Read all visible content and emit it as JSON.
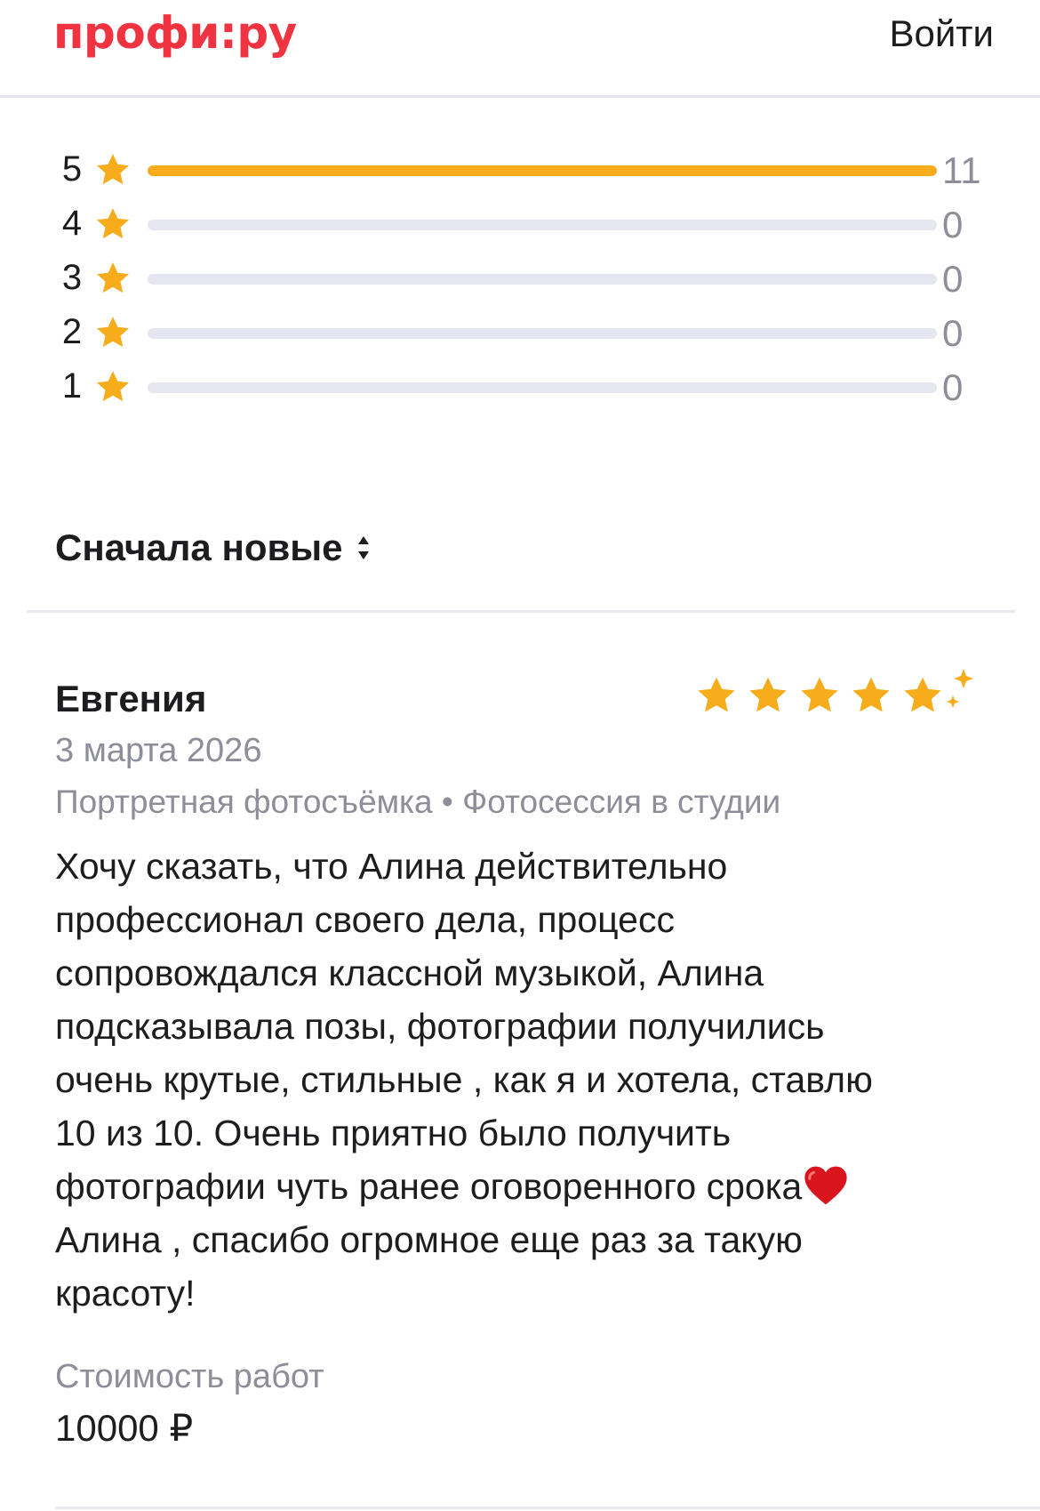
{
  "header": {
    "logo": "профи:ру",
    "login_label": "Войти"
  },
  "rating_breakdown": [
    {
      "stars": "5",
      "count": "11",
      "fill_fraction": 1.0
    },
    {
      "stars": "4",
      "count": "0",
      "fill_fraction": 0.0
    },
    {
      "stars": "3",
      "count": "0",
      "fill_fraction": 0.0
    },
    {
      "stars": "2",
      "count": "0",
      "fill_fraction": 0.0
    },
    {
      "stars": "1",
      "count": "0",
      "fill_fraction": 0.0
    }
  ],
  "sort": {
    "label": "Сначала новые"
  },
  "review": {
    "author": "Евгения",
    "rating": 5,
    "date": "3 марта 2026",
    "tags": "Портретная фотосъёмка • Фотосессия в студии",
    "text_part1": "Хочу сказать, что Алина действительно\nпрофессионал своего дела, процесс\nсопровождался классной музыкой, Алина\nподсказывала позы, фотографии получились\nочень крутые, стильные , как я и хотела, ставлю\n10 из 10. Очень приятно было получить\nфотографии чуть ранее оговоренного срока",
    "text_part2": "\nАлина , спасибо огромное еще раз за такую\nкрасоту!",
    "cost_label": "Стоимость работ",
    "cost_value": "10000 ₽"
  },
  "colors": {
    "brand": "#ef3340",
    "star": "#f7ac1b",
    "muted_text": "#8e8e99",
    "bar_track": "#e5e6ef"
  },
  "icons": [
    "star-icon",
    "sort-arrows-icon",
    "sparkle-icon",
    "heart-icon"
  ]
}
